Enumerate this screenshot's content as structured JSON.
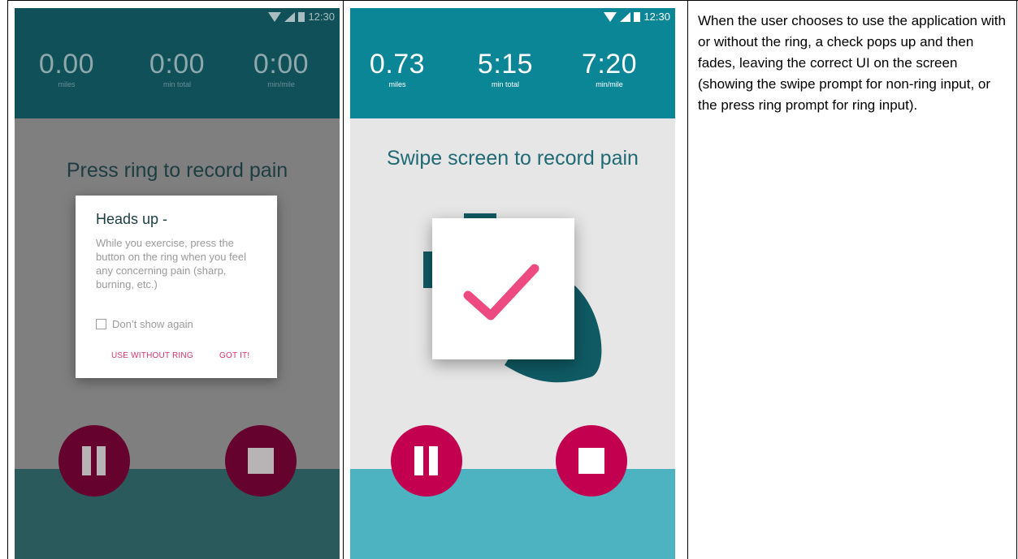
{
  "status_time": "12:30",
  "phone1": {
    "stats": [
      {
        "value": "0.00",
        "label": "miles"
      },
      {
        "value": "0:00",
        "label": "min total"
      },
      {
        "value": "0:00",
        "label": "min/mile"
      }
    ],
    "prompt": "Press ring to record pain",
    "dialog": {
      "title": "Heads up -",
      "body": "While you exercise, press the button on the ring when you feel any concerning pain (sharp, burning, etc.)",
      "checkbox_label": "Don’t show again",
      "use_without_ring": "USE WITHOUT RING",
      "got_it": "GOT IT!"
    }
  },
  "phone2": {
    "stats": [
      {
        "value": "0.73",
        "label": "miles"
      },
      {
        "value": "5:15",
        "label": "min total"
      },
      {
        "value": "7:20",
        "label": "min/mile"
      }
    ],
    "prompt": "Swipe screen to record pain"
  },
  "description": "When the user chooses to use the application with or without the ring, a check pops up and then fades, leaving the correct UI on the screen (showing the swipe prompt for non-ring input, or the press ring prompt for ring input).",
  "colors": {
    "phone1_header": "#0f5059",
    "phone2_header": "#0b8696",
    "accent_pink": "#d8326b",
    "button_phone1": "#65022e",
    "button_phone2": "#c2004f"
  },
  "icons": [
    "wifi-icon",
    "signal-icon",
    "battery-icon",
    "pause-icon",
    "stop-icon",
    "checkmark-icon",
    "checkbox-icon"
  ]
}
